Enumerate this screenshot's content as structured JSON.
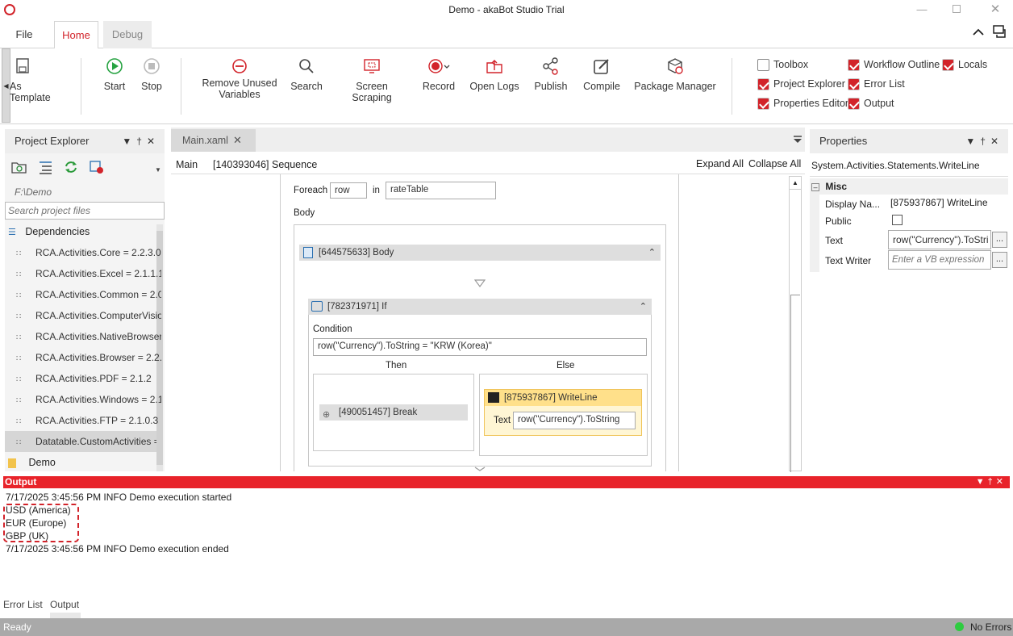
{
  "window": {
    "title": "Demo - akaBot Studio Trial"
  },
  "tabs": {
    "file": "File",
    "home": "Home",
    "debug": "Debug"
  },
  "ribbon": {
    "as_template": "As Template",
    "start": "Start",
    "stop": "Stop",
    "remove_unused_1": "Remove Unused",
    "remove_unused_2": "Variables",
    "search": "Search",
    "screen_scraping": "Screen Scraping",
    "record": "Record",
    "open_logs": "Open Logs",
    "publish": "Publish",
    "compile": "Compile",
    "package_manager": "Package Manager",
    "toggles": {
      "toolbox": "Toolbox",
      "workflow_outline": "Workflow Outline",
      "locals": "Locals",
      "project_explorer": "Project Explorer",
      "error_list": "Error List",
      "properties_editor": "Properties Editor",
      "output": "Output"
    }
  },
  "project_explorer": {
    "title": "Project Explorer",
    "path": "F:\\Demo",
    "search_placeholder": "Search project files",
    "dependencies_label": "Dependencies",
    "dependencies": [
      "RCA.Activities.Core = 2.2.3.0",
      "RCA.Activities.Excel = 2.1.1.1",
      "RCA.Activities.Common = 2.0",
      "RCA.Activities.ComputerVision",
      "RCA.Activities.NativeBrowser",
      "RCA.Activities.Browser = 2.2.",
      "RCA.Activities.PDF = 2.1.2",
      "RCA.Activities.Windows = 2.1",
      "RCA.Activities.FTP = 2.1.0.3",
      "Datatable.CustomActivities ="
    ],
    "project_label": "Demo"
  },
  "designer": {
    "tab": "Main.xaml",
    "breadcrumb_main": "Main",
    "breadcrumb_seq": "[140393046] Sequence",
    "expand_all": "Expand All",
    "collapse_all": "Collapse All",
    "foreach_label": "Foreach",
    "foreach_var": "row",
    "in_label": "in",
    "foreach_collection": "rateTable",
    "body_label": "Body",
    "body_header": "[644575633] Body",
    "if_header": "[782371971] If",
    "condition_label": "Condition",
    "condition": "row(\"Currency\").ToString = \"KRW (Korea)\"",
    "then_label": "Then",
    "else_label": "Else",
    "break_label": "[490051457] Break",
    "writeline_header": "[875937867] WriteLine",
    "text_label": "Text",
    "writeline_text": "row(\"Currency\").ToString"
  },
  "properties": {
    "title": "Properties",
    "type": "System.Activities.Statements.WriteLine",
    "category": "Misc",
    "rows": {
      "display_name_label": "Display Na...",
      "display_name_value": "[875937867] WriteLine",
      "public_label": "Public",
      "text_label": "Text",
      "text_value": "row(\"Currency\").ToStri",
      "text_writer_label": "Text Writer",
      "text_writer_placeholder": "Enter a VB expression"
    },
    "ellipsis": "..."
  },
  "output": {
    "title": "Output",
    "lines": [
      "7/17/2025 3:45:56 PM INFO Demo execution started",
      "USD (America)",
      "EUR (Europe)",
      "GBP (UK)",
      "7/17/2025 3:45:56 PM INFO Demo execution ended"
    ]
  },
  "bottom_tabs": {
    "error_list": "Error List",
    "output": "Output"
  },
  "status": {
    "ready": "Ready",
    "errors": "No Errors"
  },
  "colors": {
    "accent": "#d2232a",
    "output_header": "#e8232a",
    "status_bar": "#a9a9a9",
    "ok": "#2ecc40"
  }
}
